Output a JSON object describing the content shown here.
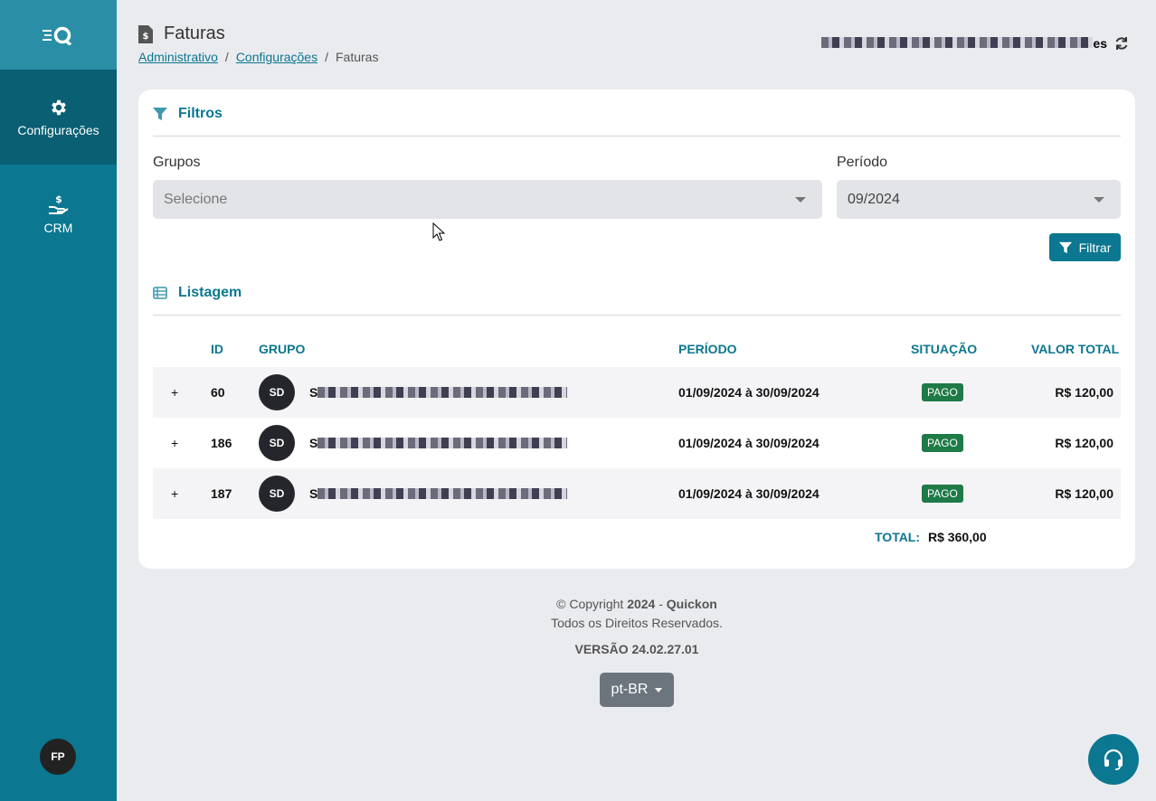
{
  "sidebar": {
    "items": [
      {
        "label": "Configurações",
        "icon": "gear-icon"
      },
      {
        "label": "CRM",
        "icon": "hand-dollar-icon"
      }
    ],
    "avatar": "FP"
  },
  "header": {
    "title": "Faturas",
    "breadcrumb": [
      "Administrativo",
      "Configurações",
      "Faturas"
    ],
    "user_suffix": "es"
  },
  "filters": {
    "title": "Filtros",
    "grupos_label": "Grupos",
    "grupos_placeholder": "Selecione",
    "periodo_label": "Período",
    "periodo_value": "09/2024",
    "filter_button": "Filtrar"
  },
  "listing": {
    "title": "Listagem",
    "columns": [
      "ID",
      "GRUPO",
      "PERÍODO",
      "SITUAÇÃO",
      "VALOR TOTAL"
    ],
    "rows": [
      {
        "id": "60",
        "avatar": "SD",
        "group_initial": "S",
        "period": "01/09/2024 à 30/09/2024",
        "status": "PAGO",
        "total": "R$ 120,00"
      },
      {
        "id": "186",
        "avatar": "SD",
        "group_initial": "S",
        "period": "01/09/2024 à 30/09/2024",
        "status": "PAGO",
        "total": "R$ 120,00"
      },
      {
        "id": "187",
        "avatar": "SD",
        "group_initial": "S",
        "period": "01/09/2024 à 30/09/2024",
        "status": "PAGO",
        "total": "R$ 120,00"
      }
    ],
    "total_label": "TOTAL:",
    "total_value": "R$ 360,00"
  },
  "footer": {
    "copyright_prefix": "© Copyright ",
    "year": "2024",
    "separator": " - ",
    "company": "Quickon",
    "rights": "Todos os Direitos Reservados.",
    "version": "VERSÃO 24.02.27.01",
    "language": "pt-BR"
  },
  "colors": {
    "primary": "#0b7790",
    "success": "#1e7a46",
    "background": "#eaebef"
  }
}
